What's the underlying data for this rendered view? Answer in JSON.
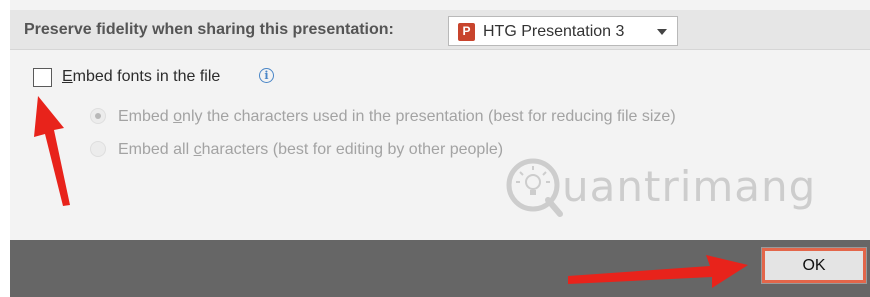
{
  "header": {
    "label": "Preserve fidelity when sharing this presentation:",
    "presentation_select": {
      "value": "HTG Presentation 3",
      "icon": "powerpoint-icon",
      "icon_letter": "P"
    }
  },
  "options": {
    "embed_fonts": {
      "label": "Embed fonts in the file",
      "checked": false,
      "info_icon": "info-icon"
    },
    "embed_only_used": {
      "prefix": "Embed ",
      "underlined": "o",
      "rest": "nly the characters used in the presentation (best for reducing file size)",
      "selected": true,
      "enabled": false
    },
    "embed_all": {
      "prefix": "Embed all ",
      "underlined": "c",
      "rest": "haracters (best for editing by other people)",
      "selected": false,
      "enabled": false
    }
  },
  "footer": {
    "ok_label": "OK"
  },
  "watermark": {
    "text": "uantrimang"
  },
  "annotation_color": "#e8231b"
}
